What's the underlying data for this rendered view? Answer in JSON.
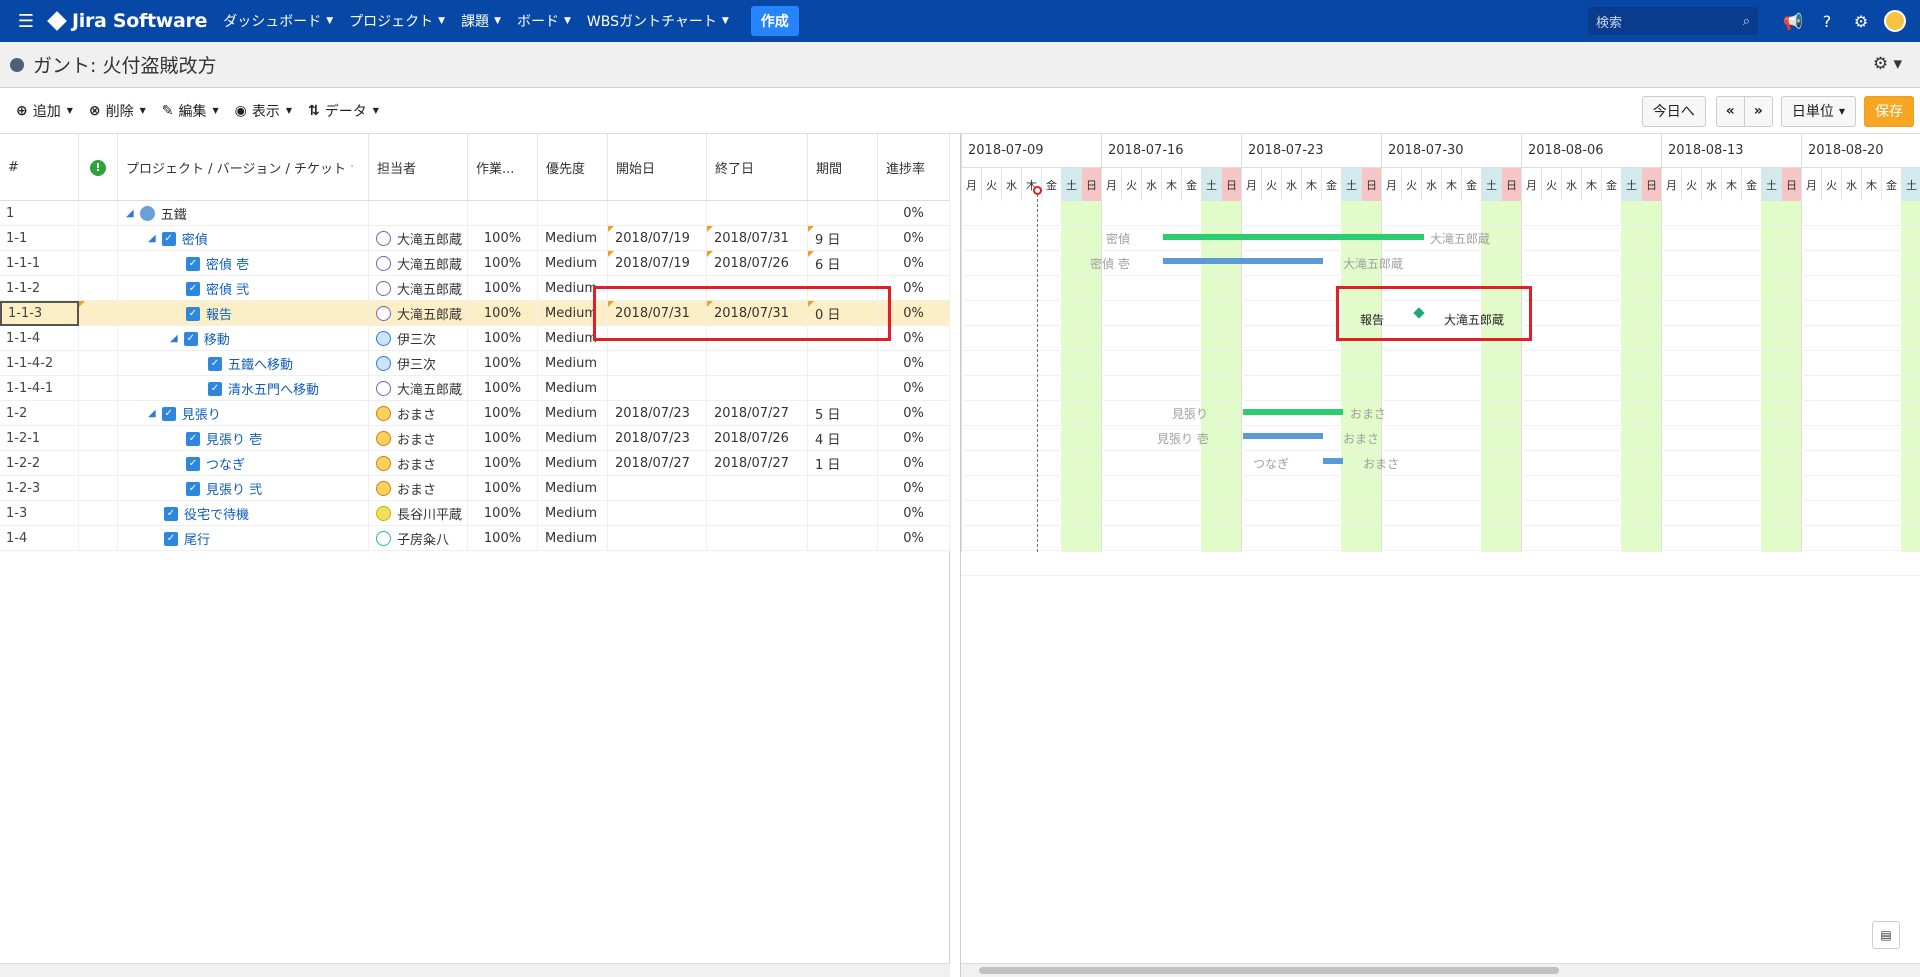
{
  "topnav": {
    "brand": "Jira Software",
    "menu": [
      {
        "label": "ダッシュボード"
      },
      {
        "label": "プロジェクト"
      },
      {
        "label": "課題"
      },
      {
        "label": "ボード"
      },
      {
        "label": "WBSガントチャート"
      }
    ],
    "create_label": "作成",
    "search_placeholder": "検索",
    "icons": [
      "megaphone-icon",
      "help-icon",
      "settings-icon",
      "user-avatar"
    ]
  },
  "page": {
    "title": "ガント: 火付盗賊改方"
  },
  "toolbar": {
    "add": "追加",
    "delete": "削除",
    "edit": "編集",
    "view": "表示",
    "data": "データ",
    "today": "今日へ",
    "prev": "«",
    "next": "»",
    "unit": "日単位",
    "save": "保存"
  },
  "columns": {
    "num": "#",
    "project": "プロジェクト / バージョン / チケット",
    "assignee": "担当者",
    "work": "作業...",
    "priority": "優先度",
    "start": "開始日",
    "end": "終了日",
    "duration": "期間",
    "progress": "進捗率"
  },
  "rows": [
    {
      "num": "1",
      "name": "五鐵",
      "assignee": "",
      "work": "",
      "priority": "",
      "start": "",
      "end": "",
      "dur": "",
      "progress": "0%"
    },
    {
      "num": "1-1",
      "name": "密偵",
      "assignee": "大滝五郎蔵",
      "work": "100%",
      "priority": "Medium",
      "start": "2018/07/19",
      "end": "2018/07/31",
      "dur": "9 日",
      "progress": "0%"
    },
    {
      "num": "1-1-1",
      "name": "密偵 壱",
      "assignee": "大滝五郎蔵",
      "work": "100%",
      "priority": "Medium",
      "start": "2018/07/19",
      "end": "2018/07/26",
      "dur": "6 日",
      "progress": "0%"
    },
    {
      "num": "1-1-2",
      "name": "密偵 弐",
      "assignee": "大滝五郎蔵",
      "work": "100%",
      "priority": "Medium",
      "start": "",
      "end": "",
      "dur": "",
      "progress": "0%"
    },
    {
      "num": "1-1-3",
      "name": "報告",
      "assignee": "大滝五郎蔵",
      "work": "100%",
      "priority": "Medium",
      "start": "2018/07/31",
      "end": "2018/07/31",
      "dur": "0 日",
      "progress": "0%"
    },
    {
      "num": "1-1-4",
      "name": "移動",
      "assignee": "伊三次",
      "work": "100%",
      "priority": "Medium",
      "start": "",
      "end": "",
      "dur": "",
      "progress": "0%"
    },
    {
      "num": "1-1-4-2",
      "name": "五鐵へ移動",
      "assignee": "伊三次",
      "work": "100%",
      "priority": "Medium",
      "start": "",
      "end": "",
      "dur": "",
      "progress": "0%"
    },
    {
      "num": "1-1-4-1",
      "name": "清水五門へ移動",
      "assignee": "大滝五郎蔵",
      "work": "100%",
      "priority": "Medium",
      "start": "",
      "end": "",
      "dur": "",
      "progress": "0%"
    },
    {
      "num": "1-2",
      "name": "見張り",
      "assignee": "おまさ",
      "work": "100%",
      "priority": "Medium",
      "start": "2018/07/23",
      "end": "2018/07/27",
      "dur": "5 日",
      "progress": "0%"
    },
    {
      "num": "1-2-1",
      "name": "見張り 壱",
      "assignee": "おまさ",
      "work": "100%",
      "priority": "Medium",
      "start": "2018/07/23",
      "end": "2018/07/26",
      "dur": "4 日",
      "progress": "0%"
    },
    {
      "num": "1-2-2",
      "name": "つなぎ",
      "assignee": "おまさ",
      "work": "100%",
      "priority": "Medium",
      "start": "2018/07/27",
      "end": "2018/07/27",
      "dur": "1 日",
      "progress": "0%"
    },
    {
      "num": "1-2-3",
      "name": "見張り 弐",
      "assignee": "おまさ",
      "work": "100%",
      "priority": "Medium",
      "start": "",
      "end": "",
      "dur": "",
      "progress": "0%"
    },
    {
      "num": "1-3",
      "name": "役宅で待機",
      "assignee": "長谷川平蔵",
      "work": "100%",
      "priority": "Medium",
      "start": "",
      "end": "",
      "dur": "",
      "progress": "0%"
    },
    {
      "num": "1-4",
      "name": "尾行",
      "assignee": "子房粂八",
      "work": "100%",
      "priority": "Medium",
      "start": "",
      "end": "",
      "dur": "",
      "progress": "0%"
    }
  ],
  "gantt": {
    "weeks": [
      "2018-07-09",
      "2018-07-16",
      "2018-07-23",
      "2018-07-30",
      "2018-08-06",
      "2018-08-13",
      "2018-08-20"
    ],
    "days": [
      "月",
      "火",
      "水",
      "木",
      "金",
      "土",
      "日"
    ],
    "bar_labels": {
      "mittei_left": "密偵",
      "mittei_right": "大滝五郎蔵",
      "mittei1_left": "密偵 壱",
      "mittei1_right": "大滝五郎蔵",
      "houkoku_left": "報告",
      "houkoku_right": "大滝五郎蔵",
      "mihari_left": "見張り",
      "mihari_right": "おまさ",
      "mihari1_left": "見張り 壱",
      "mihari1_right": "おまさ",
      "tsunagi_left": "つなぎ",
      "tsunagi_right": "おまさ"
    }
  },
  "colors": {
    "nav": "#0747a6",
    "summary_bar": "#2ecc71",
    "task_bar": "#5b9bd5",
    "highlight": "#e21f26",
    "selected_row": "#fcefc5"
  }
}
